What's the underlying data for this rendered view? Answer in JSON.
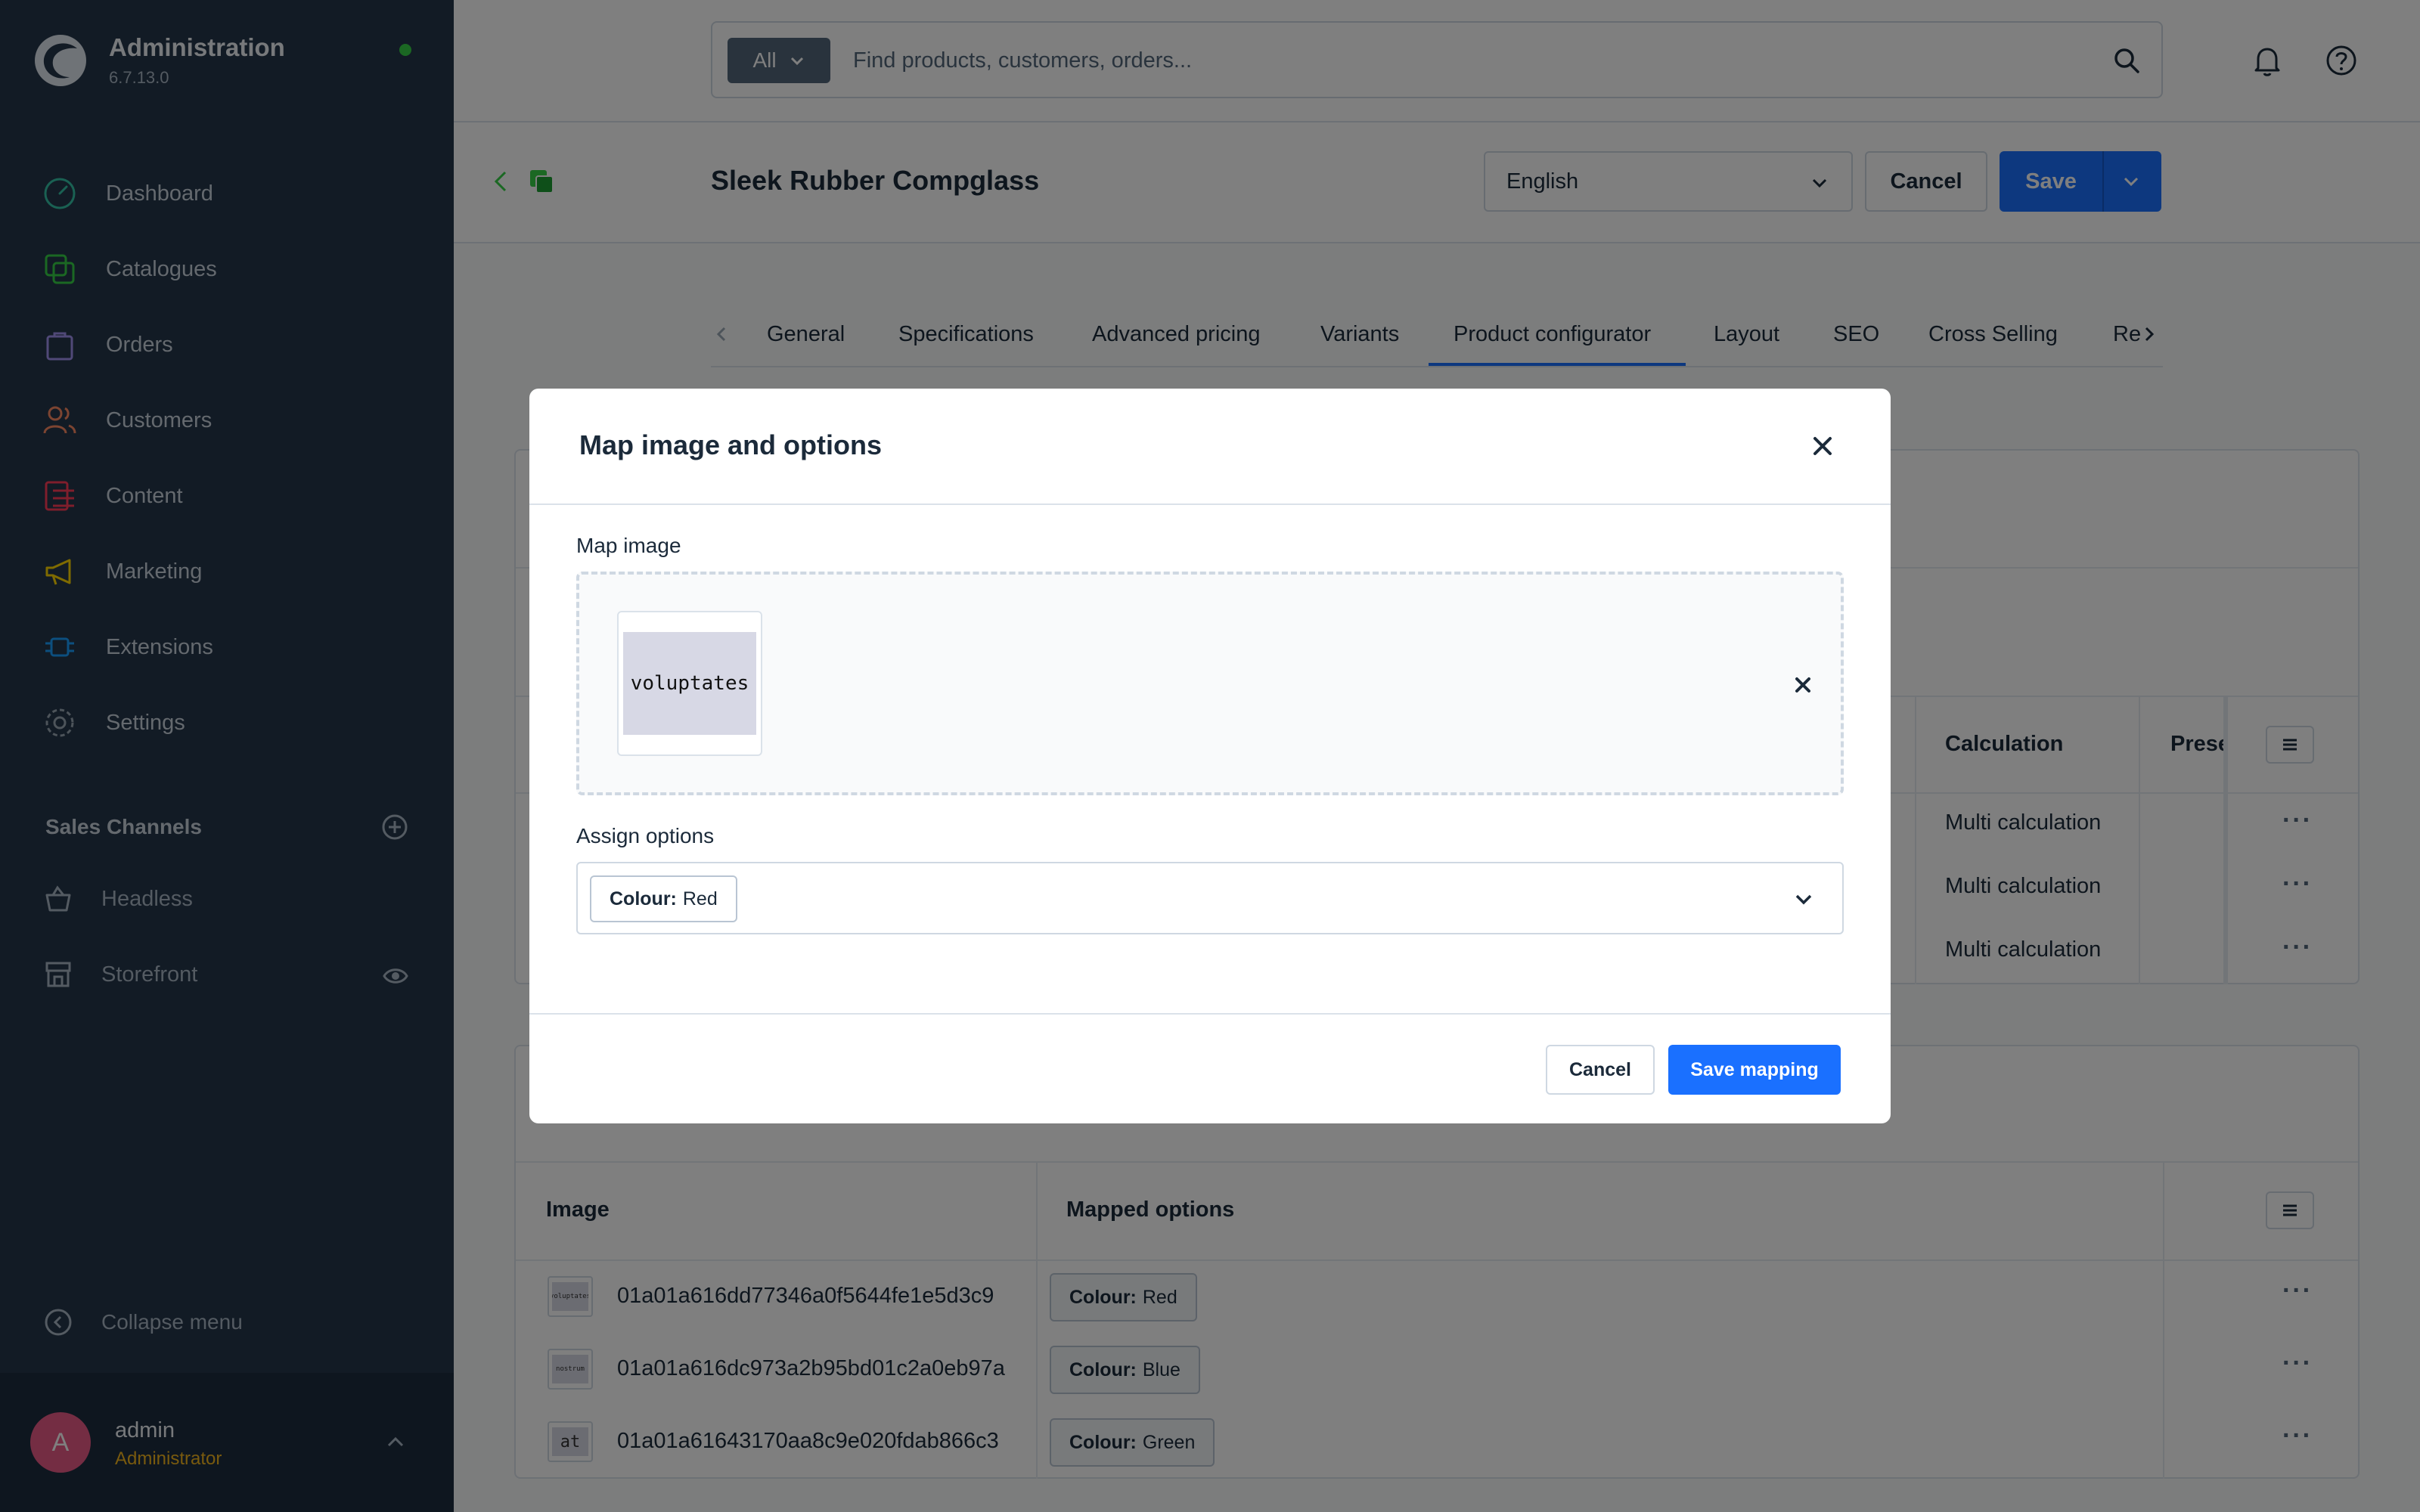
{
  "sidebar": {
    "brand_title": "Administration",
    "brand_version": "6.7.13.0",
    "nav": [
      {
        "label": "Dashboard",
        "icon": "dashboard-icon",
        "color": "#34c2a6"
      },
      {
        "label": "Catalogues",
        "icon": "catalogue-icon",
        "color": "#37d046"
      },
      {
        "label": "Orders",
        "icon": "orders-icon",
        "color": "#a092f0"
      },
      {
        "label": "Customers",
        "icon": "customers-icon",
        "color": "#f88962"
      },
      {
        "label": "Content",
        "icon": "content-icon",
        "color": "#ff3d58"
      },
      {
        "label": "Marketing",
        "icon": "marketing-icon",
        "color": "#ffd700"
      },
      {
        "label": "Extensions",
        "icon": "extensions-icon",
        "color": "#189eff"
      },
      {
        "label": "Settings",
        "icon": "settings-icon",
        "color": "#9aa8b5"
      }
    ],
    "sales_channels_title": "Sales Channels",
    "sales_channels": [
      {
        "label": "Headless"
      },
      {
        "label": "Storefront"
      }
    ],
    "collapse_label": "Collapse menu",
    "user": {
      "initial": "A",
      "name": "admin",
      "role": "Administrator"
    }
  },
  "search": {
    "scope": "All",
    "placeholder": "Find products, customers, orders..."
  },
  "header": {
    "title": "Sleek Rubber Compglass",
    "language": "English",
    "cancel_label": "Cancel",
    "save_label": "Save"
  },
  "tabs": [
    {
      "label": "General"
    },
    {
      "label": "Specifications"
    },
    {
      "label": "Advanced pricing"
    },
    {
      "label": "Variants"
    },
    {
      "label": "Product configurator",
      "active": true
    },
    {
      "label": "Layout"
    },
    {
      "label": "SEO"
    },
    {
      "label": "Cross Selling"
    },
    {
      "label": "Re"
    }
  ],
  "options_table": {
    "columns": [
      "Calculation",
      "Prese"
    ],
    "rows": [
      "Multi calculation",
      "Multi calculation",
      "Multi calculation"
    ]
  },
  "mapping_table": {
    "columns": [
      "Image",
      "Mapped options"
    ],
    "rows": [
      {
        "thumb": "voluptates",
        "id": "01a01a616dd77346a0f5644fe1e5d3c9",
        "option_name": "Colour:",
        "option_value": "Red"
      },
      {
        "thumb": "nostrum",
        "id": "01a01a616dc973a2b95bd01c2a0eb97a",
        "option_name": "Colour:",
        "option_value": "Blue"
      },
      {
        "thumb": "at",
        "id": "01a01a61643170aa8c9e020fdab866c3",
        "option_name": "Colour:",
        "option_value": "Green"
      }
    ]
  },
  "modal": {
    "title": "Map image and options",
    "map_image_label": "Map image",
    "preview_text": "voluptates",
    "assign_label": "Assign options",
    "assigned": {
      "name": "Colour:",
      "value": "Red"
    },
    "cancel_label": "Cancel",
    "save_label": "Save mapping"
  },
  "colors": {
    "sidebar_bg": "#25364a",
    "primary": "#1a70ff",
    "online": "#37d046",
    "avatar": "#e85a86",
    "role": "#f2b51d"
  }
}
